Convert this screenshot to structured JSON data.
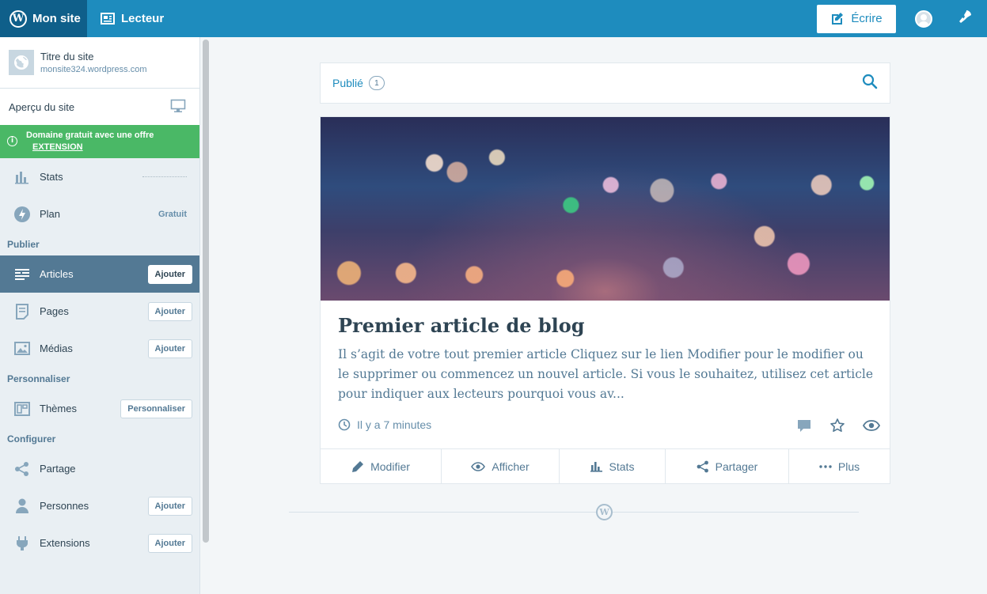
{
  "topbar": {
    "my_site_label": "Mon site",
    "reader_label": "Lecteur",
    "write_label": "Écrire",
    "brand_color": "#1e8cbe"
  },
  "sidebar": {
    "site_title": "Titre du site",
    "site_url": "monsite324.wordpress.com",
    "preview_label": "Aperçu du site",
    "promo_text": "Domaine gratuit avec une offre",
    "promo_link": "EXTENSION",
    "stats_label": "Stats",
    "plan_label": "Plan",
    "plan_value": "Gratuit",
    "section_publish": "Publier",
    "articles_label": "Articles",
    "articles_action": "Ajouter",
    "pages_label": "Pages",
    "pages_action": "Ajouter",
    "media_label": "Médias",
    "media_action": "Ajouter",
    "section_customize": "Personnaliser",
    "themes_label": "Thèmes",
    "themes_action": "Personnaliser",
    "section_configure": "Configurer",
    "sharing_label": "Partage",
    "people_label": "Personnes",
    "people_action": "Ajouter",
    "plugins_label": "Extensions",
    "plugins_action": "Ajouter"
  },
  "filter": {
    "status_label": "Publié",
    "status_count": "1"
  },
  "post": {
    "title": "Premier article de blog",
    "excerpt": "Il s’agit de votre tout premier article Cliquez sur le lien Modifier pour le modifier ou le supprimer ou commencez un nouvel article. Si vous le souhaitez, utilisez cet article pour indiquer aux lecteurs pourquoi vous av...",
    "time": "Il y a 7 minutes",
    "actions": {
      "edit": "Modifier",
      "view": "Afficher",
      "stats": "Stats",
      "share": "Partager",
      "more": "Plus"
    }
  },
  "icons": [
    "wordpress-icon",
    "reader-icon",
    "pencil-icon",
    "avatar-icon",
    "notifications-icon",
    "globe-icon",
    "monitor-icon",
    "info-icon",
    "stats-icon",
    "plan-icon",
    "posts-icon",
    "pages-icon",
    "media-icon",
    "themes-icon",
    "share-icon",
    "person-icon",
    "plugin-icon",
    "search-icon",
    "clock-icon",
    "comment-icon",
    "star-icon",
    "eye-icon",
    "ellipsis-icon"
  ]
}
